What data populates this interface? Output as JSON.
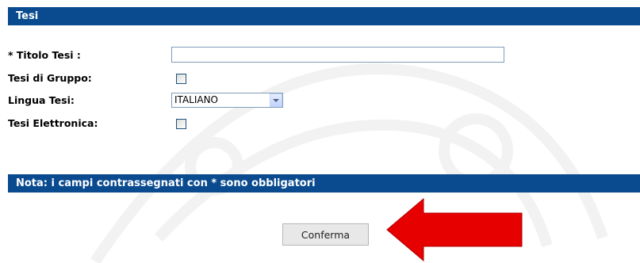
{
  "section": {
    "title": "Tesi"
  },
  "form": {
    "titolo_label": "* Titolo Tesi :",
    "titolo_value": "",
    "gruppo_label": "Tesi di Gruppo:",
    "gruppo_checked": false,
    "lingua_label": "Lingua Tesi:",
    "lingua_value": "ITALIANO",
    "elettronica_label": "Tesi Elettronica:",
    "elettronica_checked": false
  },
  "note": {
    "text": "Nota: i campi contrassegnati con * sono obbligatori"
  },
  "actions": {
    "confirm_label": "Conferma"
  },
  "colors": {
    "header_bar": "#0a4b8f",
    "arrow": "#e60000"
  },
  "icons": {
    "pointer": "red-arrow-icon",
    "dropdown": "chevron-down-icon"
  }
}
